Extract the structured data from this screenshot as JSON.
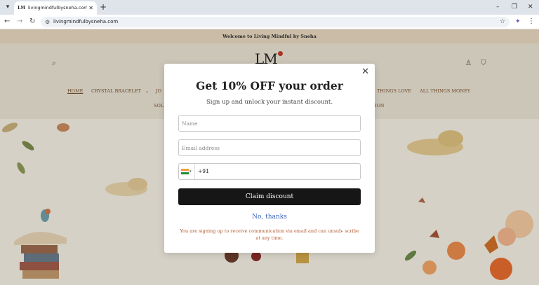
{
  "browser": {
    "tab_title": "livingmindfulbysneha.com – Li",
    "favicon_text": "LM",
    "url": "livingmindfulbysneha.com",
    "new_tab_symbol": "+",
    "tab_close_symbol": "✕",
    "tab_list_symbol": "▾",
    "window_controls": {
      "minimize": "–",
      "maximize": "❐",
      "close": "✕"
    },
    "nav": {
      "back": "←",
      "forward": "→",
      "reload": "↻"
    },
    "site_info_symbol": "⚙",
    "bookmark_symbol": "☆",
    "menu_symbol": "⋮",
    "extension_symbol": "✦"
  },
  "site": {
    "announcement": "Welcome to Living Mindful by Sneha",
    "logo_text": "LM",
    "brand_accent": "#c0392b",
    "header_icons": {
      "search": "⌕",
      "account": "♙",
      "cart": "⛉"
    },
    "nav": {
      "home": "HOME",
      "crystal_bracelet": "CRYSTAL BRACELET",
      "crystal_caret": "⌄",
      "partial_jo": "JO",
      "things_love": "THINGS LOVE",
      "all_things_money": "ALL THINGS MONEY",
      "partial_sol": "SOL",
      "partial_ion": "ION"
    }
  },
  "modal": {
    "close_symbol": "✕",
    "title": "Get 10% OFF your order",
    "subtitle": "Sign up and unlock your instant discount.",
    "name_placeholder": "Name",
    "email_placeholder": "Email address",
    "country_code": "+91",
    "flag_caret": "▾",
    "flag_colors": [
      "#f39c3d",
      "#ffffff",
      "#1f8a3b"
    ],
    "claim_button": "Claim discount",
    "no_thanks": "No, thanks",
    "disclaimer": "You are signing up to receive communication via email and can unsub- scribe at any time."
  }
}
